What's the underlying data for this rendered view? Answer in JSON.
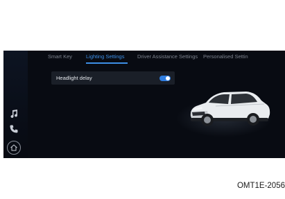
{
  "tabs": [
    {
      "label": "Smart Key",
      "active": false
    },
    {
      "label": "Lighting Settings",
      "active": true
    },
    {
      "label": "Driver Assistance Settings",
      "active": false
    },
    {
      "label": "Personalised Settin",
      "active": false
    }
  ],
  "setting": {
    "label": "Headlight delay",
    "enabled": true
  },
  "sidebar": {
    "icons": [
      "music-note-icon",
      "phone-icon",
      "home-icon"
    ]
  },
  "caption": "OMT1E-2056",
  "colors": {
    "accent": "#3d8fe6",
    "toggle_on": "#2f7de0",
    "screen_bg": "#080b12"
  }
}
